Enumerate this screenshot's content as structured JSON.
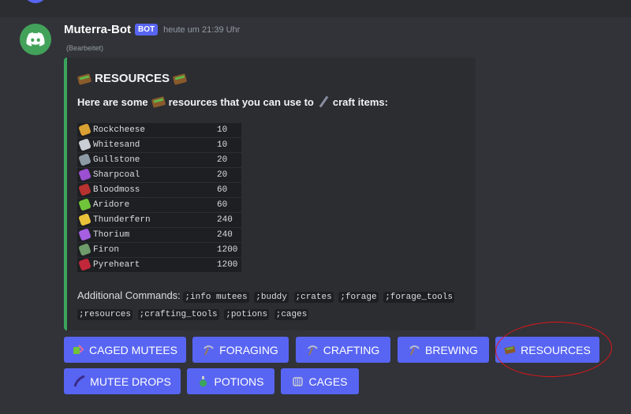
{
  "message": {
    "username": "Muterra-Bot",
    "bot_tag": "BOT",
    "timestamp": "heute um 21:39 Uhr",
    "edited": "(Bearbeitet)",
    "avatar_icon": "discord-logo-icon"
  },
  "embed": {
    "accent_color": "#3ba55c",
    "title": "RESOURCES",
    "description_part1": "Here are some",
    "description_part2": "resources that you can use to",
    "description_part3": "craft items:",
    "resources": [
      {
        "name": "Rockcheese",
        "value": "10",
        "color": "#d9a032"
      },
      {
        "name": "Whitesand",
        "value": "10",
        "color": "#c9cdd4"
      },
      {
        "name": "Gullstone",
        "value": "20",
        "color": "#8c9aa6"
      },
      {
        "name": "Sharpcoal",
        "value": "20",
        "color": "#9b4fd1"
      },
      {
        "name": "Bloodmoss",
        "value": "60",
        "color": "#b8322f"
      },
      {
        "name": "Aridore",
        "value": "60",
        "color": "#6fc43a"
      },
      {
        "name": "Thunderfern",
        "value": "240",
        "color": "#e9c23a"
      },
      {
        "name": "Thorium",
        "value": "240",
        "color": "#a65fe0"
      },
      {
        "name": "Firon",
        "value": "1200",
        "color": "#6e9c6a"
      },
      {
        "name": "Pyreheart",
        "value": "1200",
        "color": "#c2283a"
      }
    ],
    "additional_label": "Additional Commands:",
    "commands": [
      ";info mutees",
      ";buddy",
      ";crates",
      ";forage",
      ";forage_tools",
      ";resources",
      ";crafting_tools",
      ";potions",
      ";cages"
    ]
  },
  "buttons": [
    {
      "label": "CAGED MUTEES",
      "icon": "caged-mutees-icon"
    },
    {
      "label": "FORAGING",
      "icon": "pickaxe-icon"
    },
    {
      "label": "CRAFTING",
      "icon": "pickaxe-icon"
    },
    {
      "label": "BREWING",
      "icon": "pickaxe-icon"
    },
    {
      "label": "RESOURCES",
      "icon": "chest-icon"
    },
    {
      "label": "MUTEE DROPS",
      "icon": "feather-icon"
    },
    {
      "label": "POTIONS",
      "icon": "potion-icon"
    },
    {
      "label": "CAGES",
      "icon": "cage-icon"
    }
  ],
  "colors": {
    "button": "#5865f2",
    "annotation": "#e0161a"
  }
}
